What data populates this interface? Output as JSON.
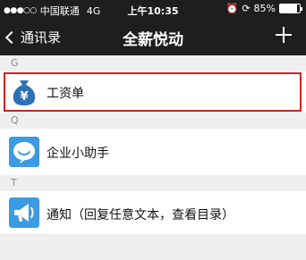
{
  "status_bar": {
    "signal": "●●●○○",
    "carrier": "中国联通",
    "network": "4G",
    "time": "上午10:35",
    "alarm_icon": "alarm-icon",
    "rotation_icon": "rotation-lock-icon",
    "battery_percent": "85%",
    "battery_level": 0.85
  },
  "nav": {
    "back_label": "通讯录",
    "title": "全薪悦动",
    "add_icon": "plus-icon"
  },
  "sections": [
    {
      "letter": "G",
      "items": [
        {
          "label": "工资单",
          "icon": "money-bag-icon",
          "highlighted": true
        }
      ]
    },
    {
      "letter": "Q",
      "items": [
        {
          "label": "企业小助手",
          "icon": "chat-bubble-icon"
        }
      ]
    },
    {
      "letter": "T",
      "items": [
        {
          "label": "通知（回复任意文本，查看目录）",
          "icon": "megaphone-icon"
        }
      ]
    }
  ],
  "colors": {
    "header_bg": "#1e1e1e",
    "highlight": "#c82224",
    "icon_blue": "#2f6fb3",
    "icon_light_blue": "#3b9be3"
  }
}
